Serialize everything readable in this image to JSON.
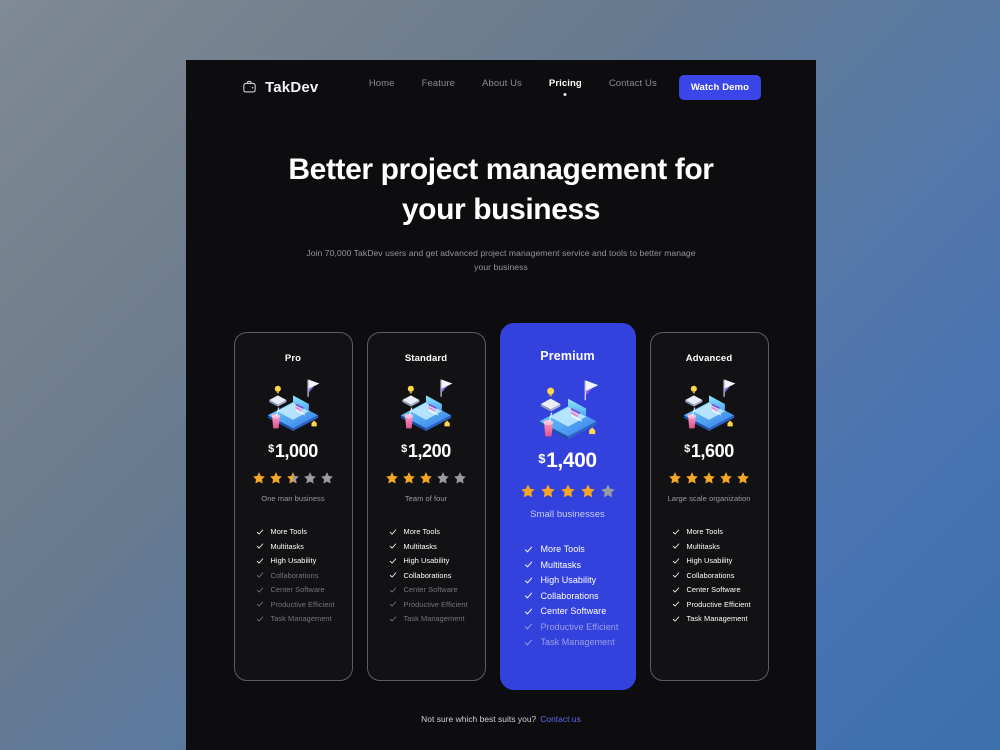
{
  "theme": {
    "page_bg": "#0d0d0f",
    "accent": "#3341dd",
    "accent_button": "#3b46e8",
    "star_on": "#f5a623",
    "star_off": "#9a9aa2",
    "link": "#5b6bf0"
  },
  "nav": {
    "logo_icon": "wallet-icon",
    "brand": "TakDev",
    "links": [
      {
        "label": "Home",
        "active": false
      },
      {
        "label": "Feature",
        "active": false
      },
      {
        "label": "About Us",
        "active": false
      },
      {
        "label": "Pricing",
        "active": true
      },
      {
        "label": "Contact Us",
        "active": false
      }
    ],
    "cta": "Watch Demo"
  },
  "hero": {
    "title_line1": "Better project management for",
    "title_line2": "your business",
    "subtitle": "Join 70,000 TakDev users and get advanced project management service and tools to better manage your business"
  },
  "pricing": {
    "plans": [
      {
        "name": "Pro",
        "currency": "$",
        "price": "1,000",
        "rating": 2.5,
        "audience": "One man business",
        "featured": false,
        "features": [
          {
            "label": "More Tools",
            "included": true
          },
          {
            "label": "Multitasks",
            "included": true
          },
          {
            "label": "High Usability",
            "included": true
          },
          {
            "label": "Collaborations",
            "included": false
          },
          {
            "label": "Center Software",
            "included": false
          },
          {
            "label": "Productive Efficient",
            "included": false
          },
          {
            "label": "Task Management",
            "included": false
          }
        ]
      },
      {
        "name": "Standard",
        "currency": "$",
        "price": "1,200",
        "rating": 3,
        "audience": "Team of four",
        "featured": false,
        "features": [
          {
            "label": "More Tools",
            "included": true
          },
          {
            "label": "Multitasks",
            "included": true
          },
          {
            "label": "High Usability",
            "included": true
          },
          {
            "label": "Collaborations",
            "included": true
          },
          {
            "label": "Center Software",
            "included": false
          },
          {
            "label": "Productive Efficient",
            "included": false
          },
          {
            "label": "Task Management",
            "included": false
          }
        ]
      },
      {
        "name": "Premium",
        "currency": "$",
        "price": "1,400",
        "rating": 4,
        "audience": "Small businesses",
        "featured": true,
        "features": [
          {
            "label": "More Tools",
            "included": true
          },
          {
            "label": "Multitasks",
            "included": true
          },
          {
            "label": "High Usability",
            "included": true
          },
          {
            "label": "Collaborations",
            "included": true
          },
          {
            "label": "Center Software",
            "included": true
          },
          {
            "label": "Productive Efficient",
            "included": false
          },
          {
            "label": "Task Management",
            "included": false
          }
        ]
      },
      {
        "name": "Advanced",
        "currency": "$",
        "price": "1,600",
        "rating": 5,
        "audience": "Large scale organization",
        "featured": false,
        "features": [
          {
            "label": "More Tools",
            "included": true
          },
          {
            "label": "Multitasks",
            "included": true
          },
          {
            "label": "High Usability",
            "included": true
          },
          {
            "label": "Collaborations",
            "included": true
          },
          {
            "label": "Center Software",
            "included": true
          },
          {
            "label": "Productive Efficient",
            "included": true
          },
          {
            "label": "Task Management",
            "included": true
          }
        ]
      }
    ]
  },
  "footer": {
    "text": "Not sure which best suits you?",
    "link": "Contact us"
  }
}
